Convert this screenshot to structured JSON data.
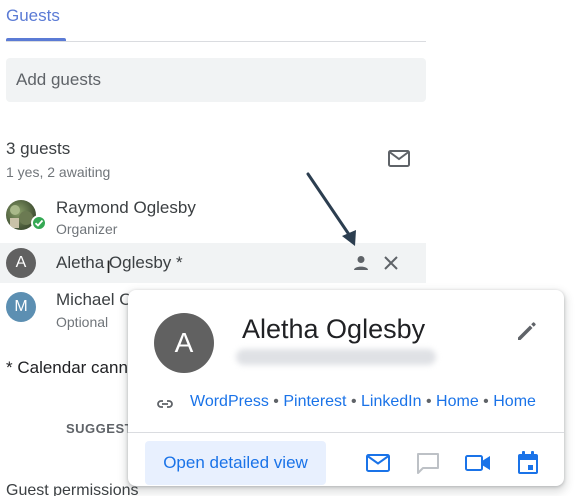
{
  "tab": {
    "label": "Guests"
  },
  "add_guests": {
    "placeholder": "Add guests"
  },
  "summary": {
    "count": "3 guests",
    "status": "1 yes, 2 awaiting"
  },
  "guests": [
    {
      "name": "Raymond Oglesby",
      "role": "Organizer",
      "initial": ""
    },
    {
      "name": "Aletha Oglesby *",
      "role": "",
      "initial": "A"
    },
    {
      "name": "Michael O",
      "role": "Optional",
      "initial": "M"
    }
  ],
  "note": "* Calendar cann",
  "suggest_label": "SUGGEST",
  "permissions_label": "Guest permissions",
  "card": {
    "initial": "A",
    "name": "Aletha Oglesby",
    "links": [
      "WordPress",
      "Pinterest",
      "LinkedIn",
      "Home",
      "Home"
    ],
    "separator": "•",
    "open_button": "Open detailed view"
  },
  "icons": {
    "email_all": "mail-outline-icon",
    "row_person": "person-icon",
    "row_remove": "close-icon",
    "edit": "pencil-icon",
    "link": "link-icon",
    "card_actions": [
      "mail-icon",
      "chat-icon",
      "video-icon",
      "calendar-icon"
    ]
  },
  "colors": {
    "accent": "#1a73e8",
    "tab_accent": "#5b7bd5",
    "avatar_gray": "#616161",
    "avatar_blue": "#5c8fb2",
    "check_green": "#34a853",
    "arrow": "#2c3e50",
    "disabled_icon": "#bdc1c6"
  }
}
